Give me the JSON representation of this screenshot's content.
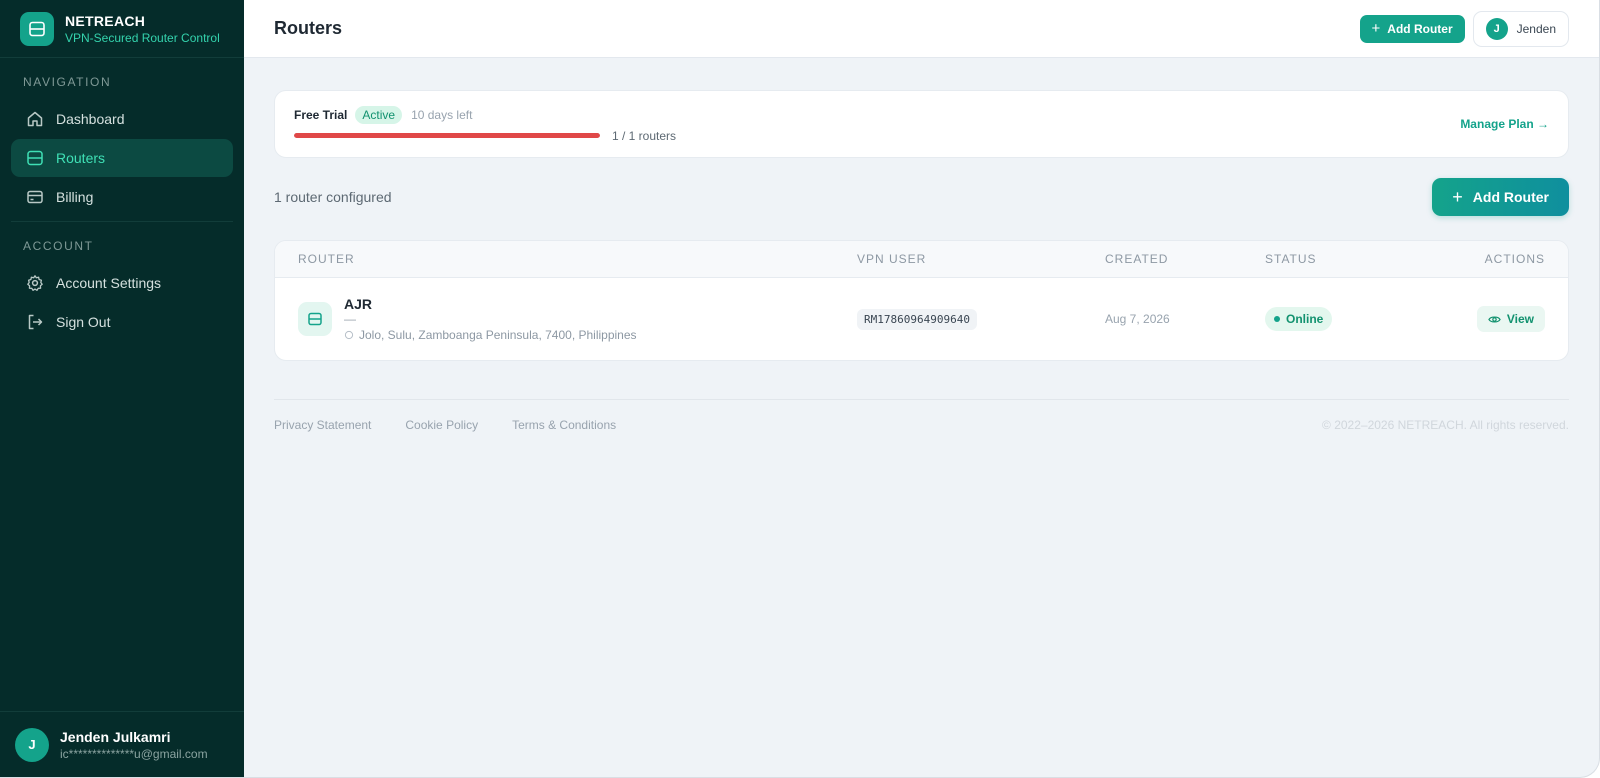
{
  "brand": {
    "name": "NETREACH",
    "tagline": "VPN-Secured Router Control"
  },
  "sidebar": {
    "navigation_heading": "NAVIGATION",
    "account_heading": "ACCOUNT",
    "nav_items": [
      {
        "label": "Dashboard",
        "icon": "home-icon"
      },
      {
        "label": "Routers",
        "icon": "router-icon",
        "active": true
      },
      {
        "label": "Billing",
        "icon": "credit-card-icon"
      }
    ],
    "account_items": [
      {
        "label": "Account Settings",
        "icon": "gear-icon"
      },
      {
        "label": "Sign Out",
        "icon": "sign-out-icon"
      }
    ],
    "user": {
      "initial": "J",
      "name": "Jenden Julkamri",
      "email": "ic**************u@gmail.com"
    }
  },
  "header": {
    "title": "Routers",
    "add_button_label": "Add Router",
    "user_initial": "J",
    "user_name": "Jenden"
  },
  "plan": {
    "name": "Free Trial",
    "status": "Active",
    "days_left": "10 days left",
    "usage_fraction": 1.0,
    "usage_text": "1 / 1 routers",
    "manage_label": "Manage Plan →"
  },
  "routers_toolbar": {
    "count_text": "1 router configured",
    "add_button_label": "Add Router"
  },
  "table": {
    "columns": [
      "ROUTER",
      "VPN USER",
      "CREATED",
      "STATUS",
      "ACTIONS"
    ],
    "rows": [
      {
        "name": "AJR",
        "subtitle": "—",
        "location": "Jolo, Sulu, Zamboanga Peninsula, 7400, Philippines",
        "vpn_user": "RM17860964909640",
        "created": "Aug 7, 2026",
        "status": "Online",
        "action_label": "View"
      }
    ]
  },
  "footer": {
    "links": [
      "Privacy Statement",
      "Cookie Policy",
      "Terms & Conditions"
    ],
    "copyright": "© 2022–2026 NETREACH. All rights reserved."
  },
  "colors": {
    "sidebar_bg": "#052c2a",
    "accent": "#14a38b",
    "danger": "#e04848"
  }
}
